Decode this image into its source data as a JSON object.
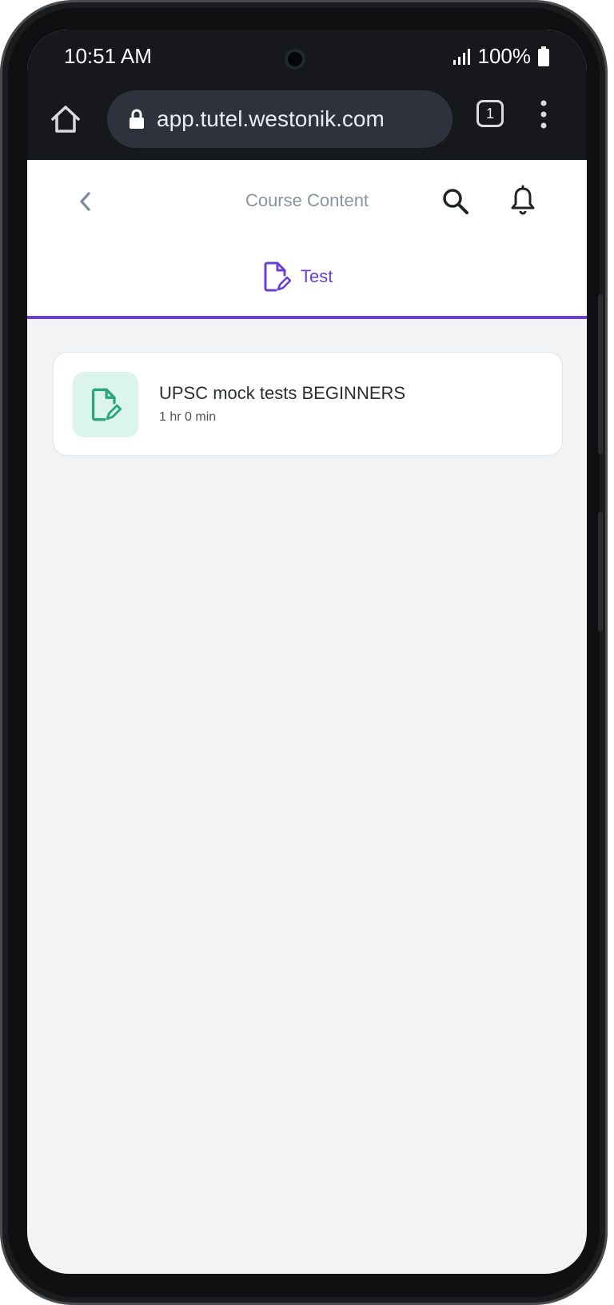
{
  "status_bar": {
    "time": "10:51 AM",
    "battery": "100%"
  },
  "browser": {
    "url": "app.tutel.westonik.com",
    "tab_count": "1"
  },
  "header": {
    "title": "Course Content"
  },
  "tabs": [
    {
      "label": "Test",
      "active": true
    }
  ],
  "content": {
    "items": [
      {
        "title": "UPSC mock tests BEGINNERS",
        "duration": "1 hr 0 min",
        "icon": "test-document-icon"
      }
    ]
  },
  "colors": {
    "accent": "#6a3fd6",
    "test_icon": "#2aa77a",
    "test_icon_bg": "#dcf5ea",
    "page_bg": "#f1f3f5"
  }
}
